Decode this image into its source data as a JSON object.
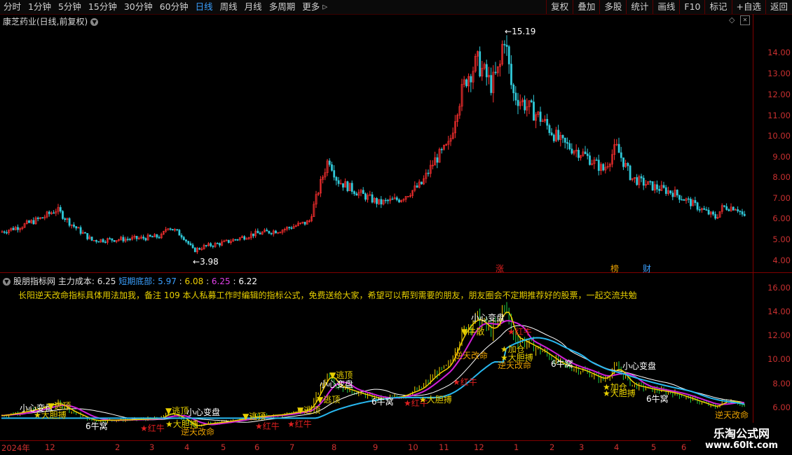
{
  "toolbar": {
    "left_items": [
      "分时",
      "1分钟",
      "5分钟",
      "15分钟",
      "30分钟",
      "60分钟",
      "日线",
      "周线",
      "月线",
      "多周期",
      "更多"
    ],
    "active_label": "日线",
    "right_items": [
      "复权",
      "叠加",
      "多股",
      "统计",
      "画线",
      "F10",
      "标记",
      "+自选",
      "返回"
    ]
  },
  "main_chart": {
    "title": "康芝药业(日线,前复权)",
    "high_label": "15.19",
    "low_label": "3.98",
    "y_ticks": [
      "14.00",
      "13.00",
      "12.00",
      "11.00",
      "10.00",
      "9.00",
      "8.00",
      "7.00",
      "6.00",
      "5.00",
      "4.00"
    ],
    "events": [
      {
        "label": "涨",
        "color": "#e02020"
      },
      {
        "label": "榜",
        "color": "#e8a000"
      },
      {
        "label": "财",
        "color": "#3aa0ff"
      }
    ]
  },
  "indicator": {
    "name": "股朋指标网",
    "main_cost_label": "主力成本:",
    "main_cost_value": "6.25",
    "short_bottom_label": "短期底部:",
    "v1": "5.97",
    "v2": "6.08",
    "v3": "6.25",
    "v4": "6.22",
    "note": "长阳逆天改命指标具体用法加我，备注 109 本人私募工作时编辑的指标公式，免费送给大家，希望可以帮到需要的朋友，朋友圈会不定期推荐好的股票，一起交流共勉",
    "y_ticks": [
      "16.00",
      "14.00",
      "12.00",
      "10.00",
      "8.00",
      "6.00"
    ],
    "annotations": {
      "caution1": "小心变盘",
      "caution2": "小心变盘",
      "caution3": "小心变盘",
      "caution4": "小心变盘",
      "escape1": "▼逃顶",
      "escape2": "▼逃顶",
      "escape3": "▼逃顶",
      "escape4": "▼逃顶",
      "escape5": "▼逃顶",
      "escape6": "▼逃顶",
      "red_bull1": "★红牛",
      "red_bull2": "★红牛",
      "red_bull3": "★红牛",
      "red_bull4": "★红牛",
      "red_bull5": "★红牛",
      "red_bull6": "★红牛",
      "nest1": "6牛窝",
      "nest2": "6牛窝",
      "nest3": "6牛窝",
      "nest4": "6牛窝",
      "bold1": "★大胆搏",
      "bold2": "★大胆搏",
      "bold3": "★大胆搏",
      "bold4": "★大胆搏",
      "fate1": "逆天改命",
      "fate2": "逆天改命",
      "fate3": "逆天改命",
      "fate4": "逆天改命",
      "add1": "★加仓",
      "add2": "★加仓",
      "bullrun": "▼牛散"
    }
  },
  "x_axis": {
    "labels": [
      "2024年",
      "12",
      "2",
      "3",
      "4",
      "5",
      "6",
      "7",
      "8",
      "9",
      "10",
      "11",
      "12",
      "1",
      "2",
      "3",
      "4",
      "5",
      "6"
    ]
  },
  "watermark": {
    "line1": "乐淘公式网",
    "line2": "www.60lt.com"
  },
  "colors": {
    "up": "#ff3030",
    "down": "#30c8d8",
    "grid": "#800000",
    "axis_text": "#c83030",
    "cost_line": "#28b8f0",
    "ma_magenta": "#d020d8",
    "ma_yellow": "#f0d000",
    "ma_white": "#ffffff",
    "ma_green": "#20d040"
  }
}
